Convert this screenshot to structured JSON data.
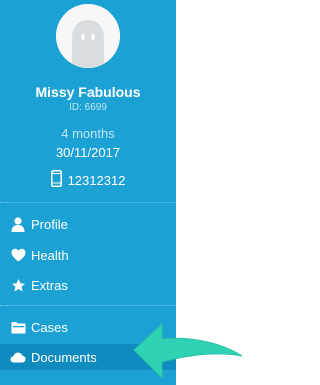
{
  "profile": {
    "name": "Missy Fabulous",
    "id_label": "ID: 6699",
    "age": "4 months",
    "dob": "30/11/2017",
    "phone": "12312312"
  },
  "nav": {
    "items": [
      {
        "label": "Profile",
        "icon": "person-icon"
      },
      {
        "label": "Health",
        "icon": "heart-icon"
      },
      {
        "label": "Extras",
        "icon": "star-icon"
      },
      {
        "label": "Cases",
        "icon": "folder-icon"
      },
      {
        "label": "Documents",
        "icon": "cloud-icon",
        "active": true
      }
    ]
  },
  "colors": {
    "sidebar": "#1ba1d3",
    "active_item": "#0f8bbf",
    "arrow": "#2fd3b4"
  }
}
